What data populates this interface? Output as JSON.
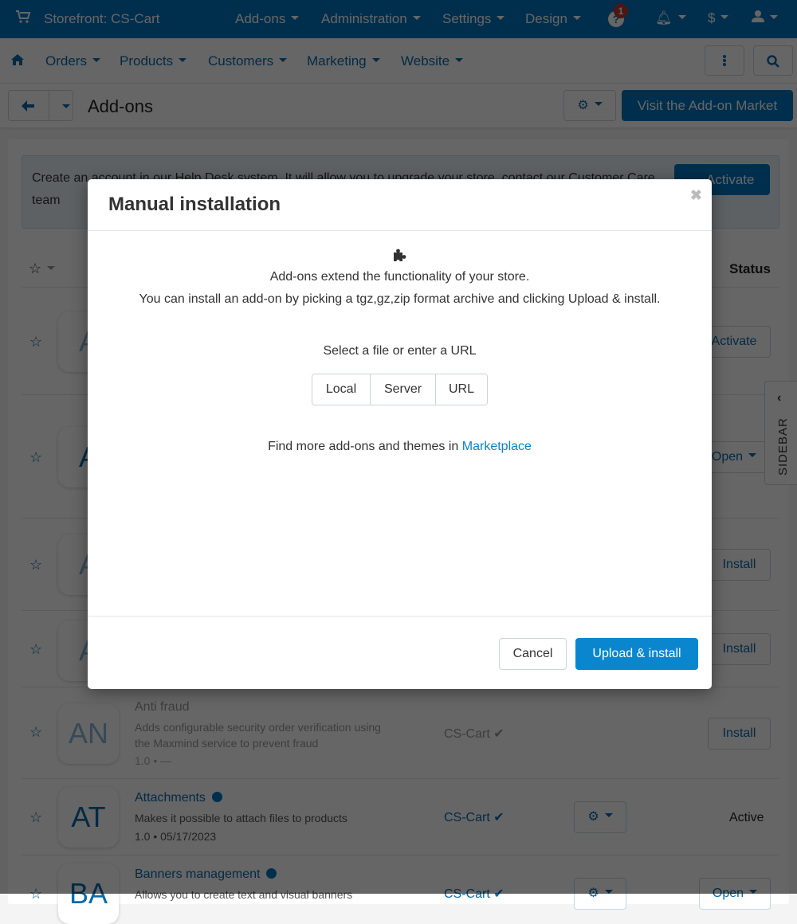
{
  "topbar": {
    "store_label": "Storefront: CS-Cart",
    "menus": [
      "Add-ons",
      "Administration",
      "Settings",
      "Design"
    ],
    "help_badge_count": "1",
    "currency_label": "$"
  },
  "subnav": {
    "items": [
      "Orders",
      "Products",
      "Customers",
      "Marketing",
      "Website"
    ]
  },
  "titlebar": {
    "title": "Add-ons",
    "market_button": "Visit the Add-on Market"
  },
  "notice": {
    "text": "Create an account in our Help Desk system. It will allow you to upgrade your store, contact our Customer Care team",
    "activate_button": "Activate"
  },
  "table": {
    "status_header": "Status",
    "rows": [
      {
        "logo": "A",
        "action": "Activate"
      },
      {
        "logo": "A",
        "action": "Open"
      },
      {
        "logo": "A",
        "action": "Install"
      },
      {
        "logo": "A",
        "action": "Install"
      },
      {
        "logo": "AN",
        "name": "Anti fraud",
        "description": "Adds configurable security order verification using the Maxmind service to prevent fraud",
        "version": "1.0 • —",
        "developer": "CS-Cart",
        "action": "Install"
      },
      {
        "logo": "AT",
        "name": "Attachments",
        "description": "Makes it possible to attach files to products",
        "version": "1.0 • 05/17/2023",
        "developer": "CS-Cart",
        "status": "Active"
      },
      {
        "logo": "BA",
        "name": "Banners management",
        "description": "Allows you to create text and visual banners",
        "developer": "CS-Cart",
        "action": "Open"
      }
    ]
  },
  "sidebar_tab": {
    "label": "SIDEBAR"
  },
  "modal": {
    "title": "Manual installation",
    "line1": "Add-ons extend the functionality of your store.",
    "line2": "You can install an add-on by picking a tgz,gz,zip format archive and clicking Upload & install.",
    "select_prompt": "Select a file or enter a URL",
    "sources": [
      "Local",
      "Server",
      "URL"
    ],
    "find_more_text": "Find more add-ons and themes in ",
    "marketplace_link": "Marketplace",
    "cancel_button": "Cancel",
    "upload_button": "Upload & install"
  },
  "colors": {
    "brand": "#0175c1",
    "link": "#0b6aab",
    "primary_button": "#0a86cf",
    "badge": "#c0392b"
  }
}
